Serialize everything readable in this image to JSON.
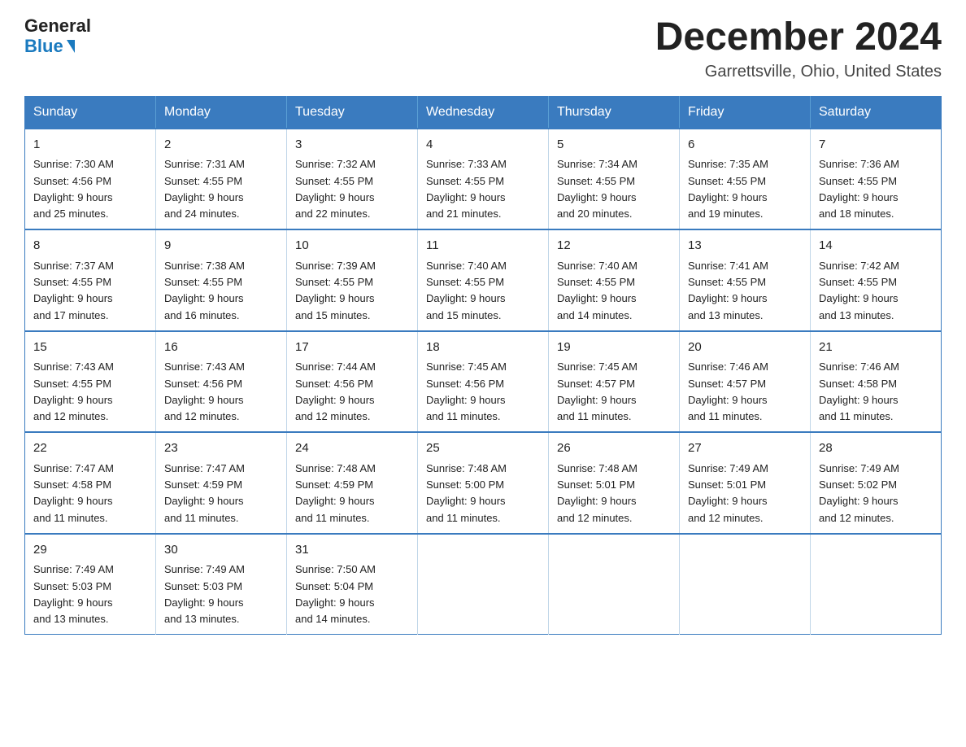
{
  "logo": {
    "general": "General",
    "blue": "Blue"
  },
  "title": "December 2024",
  "location": "Garrettsville, Ohio, United States",
  "days_of_week": [
    "Sunday",
    "Monday",
    "Tuesday",
    "Wednesday",
    "Thursday",
    "Friday",
    "Saturday"
  ],
  "weeks": [
    [
      {
        "day": "1",
        "sunrise": "7:30 AM",
        "sunset": "4:56 PM",
        "daylight": "9 hours and 25 minutes."
      },
      {
        "day": "2",
        "sunrise": "7:31 AM",
        "sunset": "4:55 PM",
        "daylight": "9 hours and 24 minutes."
      },
      {
        "day": "3",
        "sunrise": "7:32 AM",
        "sunset": "4:55 PM",
        "daylight": "9 hours and 22 minutes."
      },
      {
        "day": "4",
        "sunrise": "7:33 AM",
        "sunset": "4:55 PM",
        "daylight": "9 hours and 21 minutes."
      },
      {
        "day": "5",
        "sunrise": "7:34 AM",
        "sunset": "4:55 PM",
        "daylight": "9 hours and 20 minutes."
      },
      {
        "day": "6",
        "sunrise": "7:35 AM",
        "sunset": "4:55 PM",
        "daylight": "9 hours and 19 minutes."
      },
      {
        "day": "7",
        "sunrise": "7:36 AM",
        "sunset": "4:55 PM",
        "daylight": "9 hours and 18 minutes."
      }
    ],
    [
      {
        "day": "8",
        "sunrise": "7:37 AM",
        "sunset": "4:55 PM",
        "daylight": "9 hours and 17 minutes."
      },
      {
        "day": "9",
        "sunrise": "7:38 AM",
        "sunset": "4:55 PM",
        "daylight": "9 hours and 16 minutes."
      },
      {
        "day": "10",
        "sunrise": "7:39 AM",
        "sunset": "4:55 PM",
        "daylight": "9 hours and 15 minutes."
      },
      {
        "day": "11",
        "sunrise": "7:40 AM",
        "sunset": "4:55 PM",
        "daylight": "9 hours and 15 minutes."
      },
      {
        "day": "12",
        "sunrise": "7:40 AM",
        "sunset": "4:55 PM",
        "daylight": "9 hours and 14 minutes."
      },
      {
        "day": "13",
        "sunrise": "7:41 AM",
        "sunset": "4:55 PM",
        "daylight": "9 hours and 13 minutes."
      },
      {
        "day": "14",
        "sunrise": "7:42 AM",
        "sunset": "4:55 PM",
        "daylight": "9 hours and 13 minutes."
      }
    ],
    [
      {
        "day": "15",
        "sunrise": "7:43 AM",
        "sunset": "4:55 PM",
        "daylight": "9 hours and 12 minutes."
      },
      {
        "day": "16",
        "sunrise": "7:43 AM",
        "sunset": "4:56 PM",
        "daylight": "9 hours and 12 minutes."
      },
      {
        "day": "17",
        "sunrise": "7:44 AM",
        "sunset": "4:56 PM",
        "daylight": "9 hours and 12 minutes."
      },
      {
        "day": "18",
        "sunrise": "7:45 AM",
        "sunset": "4:56 PM",
        "daylight": "9 hours and 11 minutes."
      },
      {
        "day": "19",
        "sunrise": "7:45 AM",
        "sunset": "4:57 PM",
        "daylight": "9 hours and 11 minutes."
      },
      {
        "day": "20",
        "sunrise": "7:46 AM",
        "sunset": "4:57 PM",
        "daylight": "9 hours and 11 minutes."
      },
      {
        "day": "21",
        "sunrise": "7:46 AM",
        "sunset": "4:58 PM",
        "daylight": "9 hours and 11 minutes."
      }
    ],
    [
      {
        "day": "22",
        "sunrise": "7:47 AM",
        "sunset": "4:58 PM",
        "daylight": "9 hours and 11 minutes."
      },
      {
        "day": "23",
        "sunrise": "7:47 AM",
        "sunset": "4:59 PM",
        "daylight": "9 hours and 11 minutes."
      },
      {
        "day": "24",
        "sunrise": "7:48 AM",
        "sunset": "4:59 PM",
        "daylight": "9 hours and 11 minutes."
      },
      {
        "day": "25",
        "sunrise": "7:48 AM",
        "sunset": "5:00 PM",
        "daylight": "9 hours and 11 minutes."
      },
      {
        "day": "26",
        "sunrise": "7:48 AM",
        "sunset": "5:01 PM",
        "daylight": "9 hours and 12 minutes."
      },
      {
        "day": "27",
        "sunrise": "7:49 AM",
        "sunset": "5:01 PM",
        "daylight": "9 hours and 12 minutes."
      },
      {
        "day": "28",
        "sunrise": "7:49 AM",
        "sunset": "5:02 PM",
        "daylight": "9 hours and 12 minutes."
      }
    ],
    [
      {
        "day": "29",
        "sunrise": "7:49 AM",
        "sunset": "5:03 PM",
        "daylight": "9 hours and 13 minutes."
      },
      {
        "day": "30",
        "sunrise": "7:49 AM",
        "sunset": "5:03 PM",
        "daylight": "9 hours and 13 minutes."
      },
      {
        "day": "31",
        "sunrise": "7:50 AM",
        "sunset": "5:04 PM",
        "daylight": "9 hours and 14 minutes."
      },
      null,
      null,
      null,
      null
    ]
  ],
  "labels": {
    "sunrise": "Sunrise:",
    "sunset": "Sunset:",
    "daylight": "Daylight:"
  }
}
